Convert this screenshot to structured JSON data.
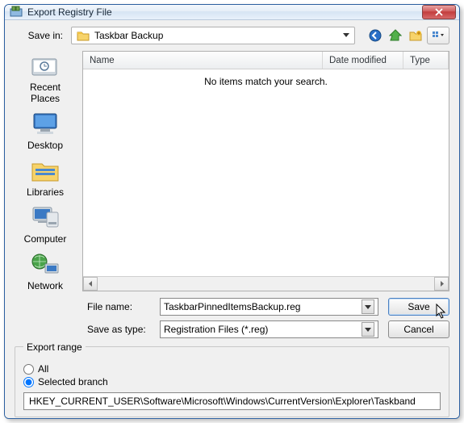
{
  "title": "Export Registry File",
  "save_in_label": "Save in:",
  "location": "Taskbar Backup",
  "columns": {
    "name": "Name",
    "date": "Date modified",
    "type": "Type"
  },
  "empty_msg": "No items match your search.",
  "places": {
    "recent": "Recent Places",
    "desktop": "Desktop",
    "libraries": "Libraries",
    "computer": "Computer",
    "network": "Network"
  },
  "form": {
    "filename_label": "File name:",
    "filename_value": "TaskbarPinnedItemsBackup.reg",
    "type_label": "Save as type:",
    "type_value": "Registration Files (*.reg)",
    "save": "Save",
    "cancel": "Cancel"
  },
  "export": {
    "legend": "Export range",
    "all": "All",
    "selected": "Selected branch",
    "branch": "HKEY_CURRENT_USER\\Software\\Microsoft\\Windows\\CurrentVersion\\Explorer\\Taskband"
  }
}
